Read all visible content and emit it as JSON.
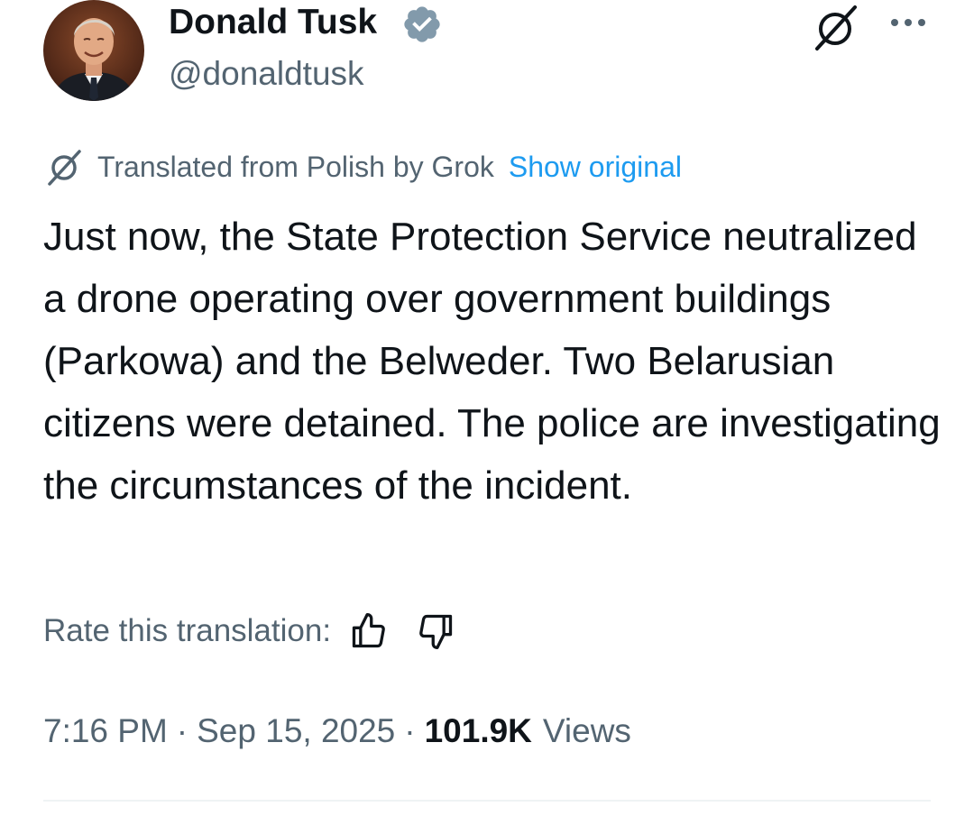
{
  "author": {
    "display_name": "Donald Tusk",
    "handle": "@donaldtusk",
    "verified_icon": "verified-badge-icon",
    "avatar": "profile-photo"
  },
  "header_icons": {
    "grok": "grok-icon",
    "more": "more-dots-icon"
  },
  "translation": {
    "icon": "grok-icon",
    "note": "Translated from Polish by Grok",
    "show_original": "Show original"
  },
  "tweet": {
    "text": "Just now, the State Protection Service neutralized a drone operating over government buildings (Parkowa) and the Belweder. Two Belarusian citizens were detained. The police are investigating the circumstances of the incident."
  },
  "rating": {
    "label": "Rate this translation:",
    "up_icon": "thumbs-up-icon",
    "down_icon": "thumbs-down-icon"
  },
  "meta": {
    "time": "7:16 PM",
    "separator": "·",
    "date": "Sep 15, 2025",
    "views_count": "101.9K",
    "views_label": "Views"
  },
  "colors": {
    "text": "#0f1419",
    "secondary": "#536471",
    "link": "#1d9bf0",
    "verified": "#829aab"
  }
}
